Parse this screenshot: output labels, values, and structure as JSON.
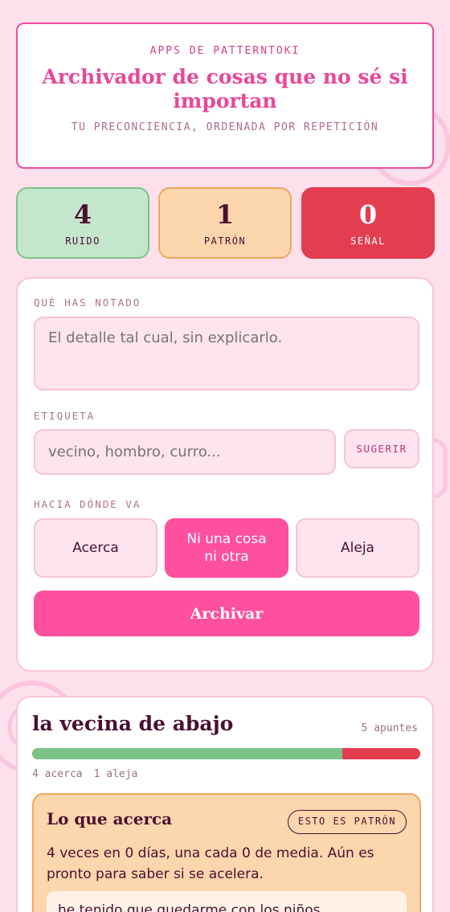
{
  "header": {
    "kicker": "APPS DE PATTERNTOKI",
    "title": "Archivador de cosas que no sé si importan",
    "subtitle": "TU PRECONCIENCIA, ORDENADA POR REPETICIÓN"
  },
  "stats": [
    {
      "value": "4",
      "label": "RUIDO"
    },
    {
      "value": "1",
      "label": "PATRÓN"
    },
    {
      "value": "0",
      "label": "SEÑAL"
    }
  ],
  "form": {
    "noticed_label": "QUÉ HAS NOTADO",
    "noticed_placeholder": "El detalle tal cual, sin explicarlo.",
    "tag_label": "ETIQUETA",
    "tag_placeholder": "vecino, hombro, curro...",
    "suggest_label": "SUGERIR",
    "direction_label": "HACIA DÓNDE VA",
    "directions": [
      "Acerca",
      "Ni una cosa ni otra",
      "Aleja"
    ],
    "selected_direction": "Ni una cosa ni otra",
    "submit_label": "Archivar"
  },
  "entry": {
    "title": "la vecina de abajo",
    "count": "5 apuntes",
    "closer_fraction": 0.8,
    "closer_count": "4 acerca",
    "away_count": "1 aleja",
    "pattern": {
      "title": "Lo que acerca",
      "badge": "ESTO ES PATRÓN",
      "text": "4 veces en 0 días, una cada 0 de media. Aún es pronto para saber si se acelera.",
      "note": "he tenido que quedarme con los niños"
    }
  },
  "colors": {
    "background": "#fde0ec",
    "accent": "#ff4f9f",
    "ruido": "#c4e6cd",
    "patron": "#fcd6ad",
    "senal": "#e43d50"
  }
}
